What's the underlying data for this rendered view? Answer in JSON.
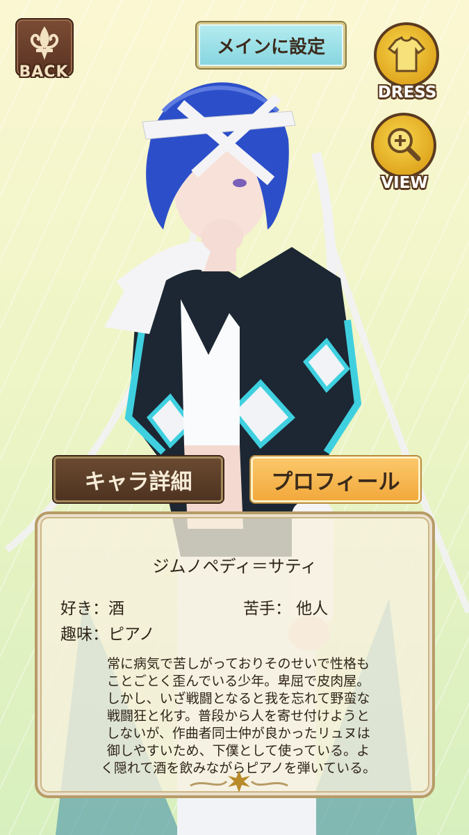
{
  "back_button": {
    "label": "BACK"
  },
  "main_button": {
    "label": "メインに設定"
  },
  "dress_button": {
    "label": "DRESS"
  },
  "view_button": {
    "label": "VIEW"
  },
  "tabs": [
    {
      "label": "キャラ詳細",
      "selected": false
    },
    {
      "label": "プロフィール",
      "selected": true
    }
  ],
  "profile": {
    "name": "ジムノペディ＝サティ",
    "likes": "好き：酒",
    "dislikes": "苦手： 他人",
    "hobby": "趣味：ピアノ",
    "description_lines": [
      "常に病気で苦しがっておりそのせいで性格も",
      "ことごとく歪んでいる少年。卑屈で皮肉屋。",
      "しかし、いざ戦闘となると我を忘れて野蛮な",
      "戦闘狂と化す。普段から人を寄せ付けようと",
      "しないが、作曲者同士仲が良かったリュヌは",
      "御しやすいため、下僕として使っている。よ",
      "く隠れて酒を飲みながらピアノを弾いている。"
    ]
  },
  "colors": {
    "hair": "#2c4fc9",
    "jacket": "#1c2733",
    "trim": "#3fd0e0",
    "bandage": "#f4f4f6"
  }
}
